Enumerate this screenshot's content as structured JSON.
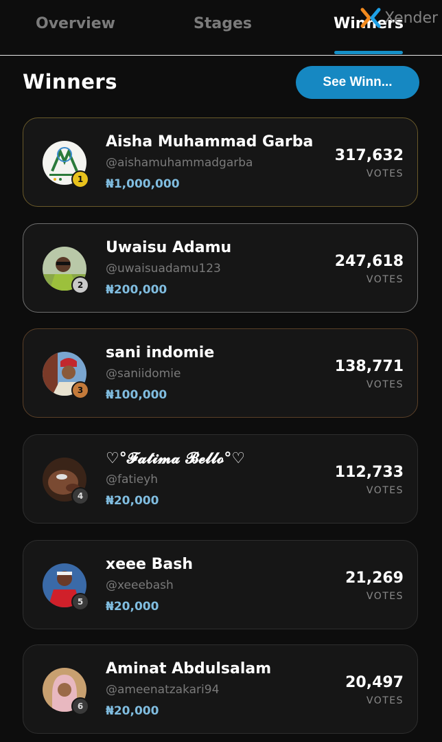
{
  "tabs": [
    {
      "label": "Overview"
    },
    {
      "label": "Stages"
    },
    {
      "label": "Winners"
    }
  ],
  "watermark": {
    "text": "Xender",
    "icon": "xender-logo"
  },
  "header": {
    "title": "Winners",
    "see_button": "See Winn..."
  },
  "winners": [
    {
      "rank": "1",
      "name": "Aisha Muhammad Garba",
      "handle": "@aishamuhammadgarba",
      "prize": "₦1,000,000",
      "votes": "317,632",
      "votes_label": "VOTES"
    },
    {
      "rank": "2",
      "name": "Uwaisu Adamu",
      "handle": "@uwaisuadamu123",
      "prize": "₦200,000",
      "votes": "247,618",
      "votes_label": "VOTES"
    },
    {
      "rank": "3",
      "name": "sani indomie",
      "handle": "@saniidomie",
      "prize": "₦100,000",
      "votes": "138,771",
      "votes_label": "VOTES"
    },
    {
      "rank": "4",
      "name": "♡°𝓕𝓪𝓽𝓲𝓶𝓪 𝓑𝓮𝓵𝓵𝓸°♡",
      "handle": "@fatieyh",
      "prize": "₦20,000",
      "votes": "112,733",
      "votes_label": "VOTES"
    },
    {
      "rank": "5",
      "name": "xeee Bash",
      "handle": "@xeeebash",
      "prize": "₦20,000",
      "votes": "21,269",
      "votes_label": "VOTES"
    },
    {
      "rank": "6",
      "name": "Aminat Abdulsalam",
      "handle": "@ameenatzakari94",
      "prize": "₦20,000",
      "votes": "20,497",
      "votes_label": "VOTES"
    }
  ],
  "colors": {
    "accent": "#1688c2",
    "prize": "#80bde0",
    "gold": "#e8c21c",
    "silver": "#c9c9c9",
    "bronze": "#c47a3a"
  }
}
